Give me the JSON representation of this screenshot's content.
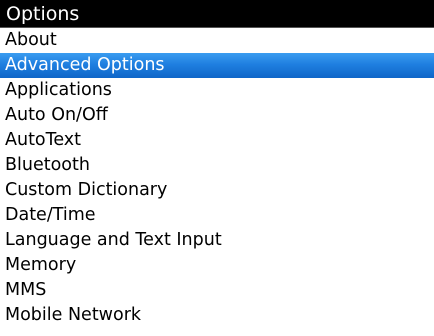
{
  "screen": {
    "title": "Options"
  },
  "menu": {
    "selected_index": 1,
    "items": [
      {
        "label": "About"
      },
      {
        "label": "Advanced Options"
      },
      {
        "label": "Applications"
      },
      {
        "label": "Auto On/Off"
      },
      {
        "label": "AutoText"
      },
      {
        "label": "Bluetooth"
      },
      {
        "label": "Custom Dictionary"
      },
      {
        "label": "Date/Time"
      },
      {
        "label": "Language and Text Input"
      },
      {
        "label": "Memory"
      },
      {
        "label": "MMS"
      },
      {
        "label": "Mobile Network"
      }
    ]
  },
  "colors": {
    "title_bg": "#000000",
    "title_fg": "#ffffff",
    "selection": "#1f7fe0"
  }
}
